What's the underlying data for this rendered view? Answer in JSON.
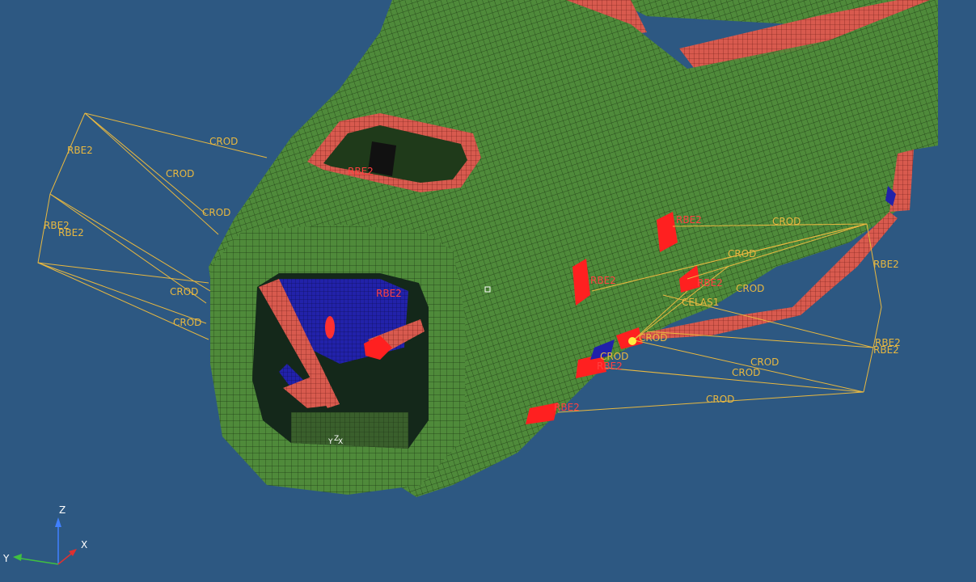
{
  "colors": {
    "background": "#2d5882",
    "shell_green": "#4f8a3a",
    "mesh_line": "#1d3a15",
    "flange_red": "#d85a4e",
    "interior_blue": "#2222aa",
    "bright_red": "#ff2020",
    "connector_yellow": "#e8b840",
    "axis_x": "#e03030",
    "axis_y": "#40c040",
    "axis_z": "#4080ff"
  },
  "labels": {
    "crod": "CROD",
    "rbe2": "RBE2",
    "celas1": "CELAS1"
  },
  "triad": {
    "x": "X",
    "y": "Y",
    "z": "Z"
  }
}
